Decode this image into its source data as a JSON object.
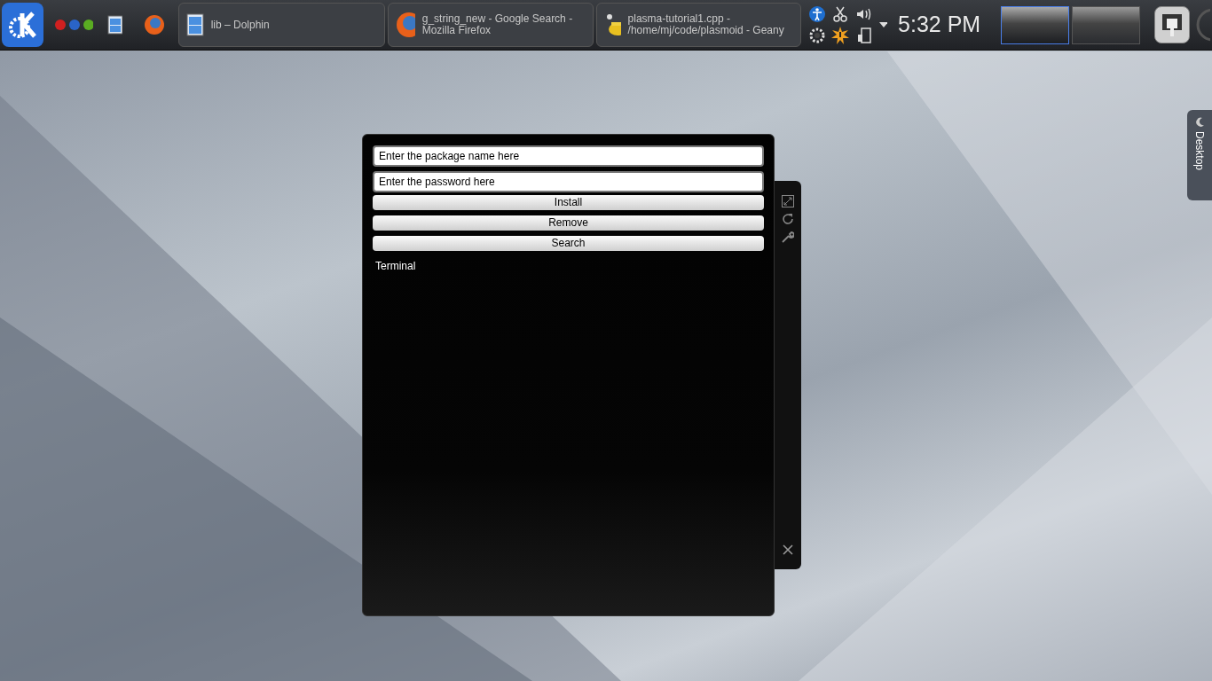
{
  "panel": {
    "tasks": [
      {
        "title": "lib – Dolphin",
        "kind": "filemanager"
      },
      {
        "title": "g_string_new - Google Search - Mozilla Firefox",
        "kind": "browser"
      },
      {
        "title": "plasma-tutorial1.cpp - /home/mj/code/plasmoid - Geany",
        "kind": "editor"
      }
    ],
    "clock": "5:32 PM",
    "pager": [
      {
        "selected": true
      },
      {
        "selected": false
      }
    ]
  },
  "widget": {
    "package_field": {
      "value": "Enter the package name here"
    },
    "password_field": {
      "value": "Enter the password here"
    },
    "buttons": [
      "Install",
      "Remove",
      "Search"
    ],
    "output": "Terminal"
  },
  "desktop_toolbox": {
    "label": "Desktop"
  }
}
